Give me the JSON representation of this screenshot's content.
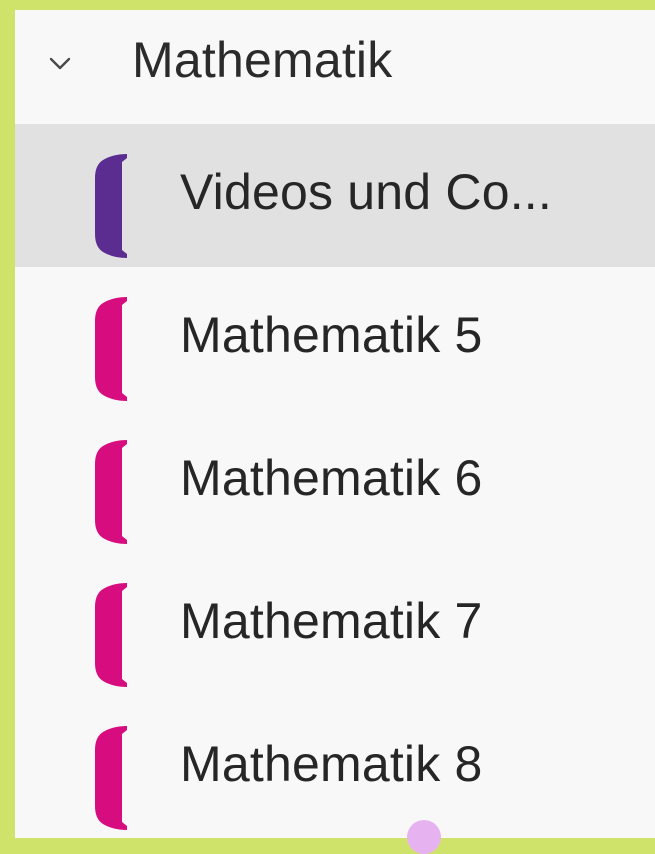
{
  "section": {
    "title": "Mathematik",
    "expanded": true,
    "icon": "chevron-down-icon"
  },
  "items": [
    {
      "label": "Videos und Co...",
      "color": "#5c2d91",
      "selected": true
    },
    {
      "label": "Mathematik 5",
      "color": "#d70c7e",
      "selected": false
    },
    {
      "label": "Mathematik 6",
      "color": "#d70c7e",
      "selected": false
    },
    {
      "label": "Mathematik 7",
      "color": "#d70c7e",
      "selected": false
    },
    {
      "label": "Mathematik 8",
      "color": "#d70c7e",
      "selected": false
    }
  ],
  "colors": {
    "background": "#cfe36a",
    "panel": "#f8f8f9",
    "selected_row": "#e1e1e2",
    "dot": "#e6b3f0"
  }
}
